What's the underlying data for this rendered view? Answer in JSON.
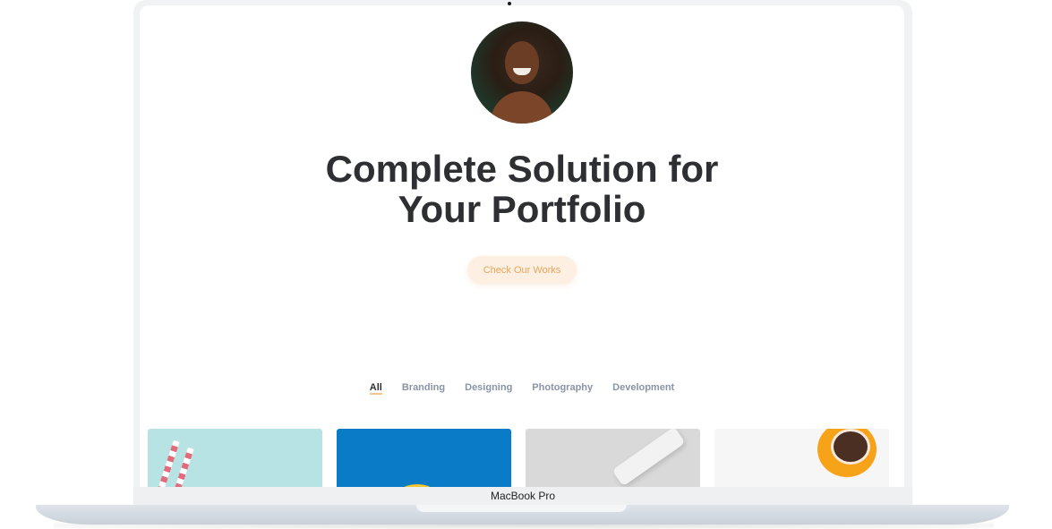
{
  "device": {
    "label": "MacBook Pro"
  },
  "hero": {
    "title_line1": "Complete Solution for",
    "title_line2": "Your Portfolio",
    "cta_label": "Check Our Works"
  },
  "filters": [
    {
      "label": "All",
      "active": true
    },
    {
      "label": "Branding",
      "active": false
    },
    {
      "label": "Designing",
      "active": false
    },
    {
      "label": "Photography",
      "active": false
    },
    {
      "label": "Development",
      "active": false
    }
  ],
  "colors": {
    "accent": "#e9a55a",
    "cta_background": "#fdf0e3",
    "heading": "#2e2f33",
    "muted_text": "#8a94a6"
  }
}
